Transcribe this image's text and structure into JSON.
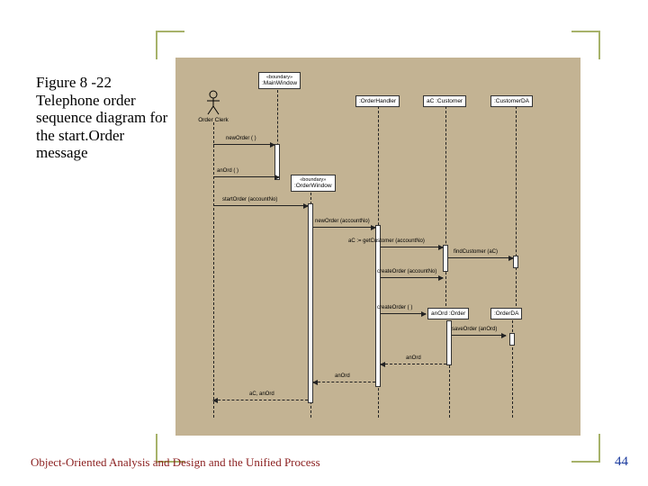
{
  "caption": {
    "line1": "Figure 8 -22",
    "line2": "Telephone order sequence diagram for the start.Order message"
  },
  "footer": {
    "left": "Object-Oriented Analysis and Design and the Unified Process",
    "page": "44"
  },
  "objects": {
    "actor": "Order Clerk",
    "boundary_stereo": "«boundary»",
    "boundary": ":MainWindow",
    "handler": ":OrderHandler",
    "customer": "aC :Customer",
    "customerDA": ":CustomerDA",
    "orderWin_stereo": "«boundary»",
    "orderWin": ":OrderWindow",
    "order": "anOrd :Order",
    "orderDA": ":OrderDA"
  },
  "messages": {
    "m1": "newOrder ( )",
    "m2": "anOrd ( )",
    "m3": "startOrder (accountNo)",
    "m4": "newOrder (accountNo)",
    "m5": "aC := getCustomer (accountNo)",
    "m6": "findCustomer (aC)",
    "m7": "createOrder (accountNo)",
    "m8": "createOrder ( )",
    "m9": "saveOrder (anOrd)",
    "r1": "anOrd",
    "r2": "anOrd",
    "r3": "aC, anOrd"
  }
}
